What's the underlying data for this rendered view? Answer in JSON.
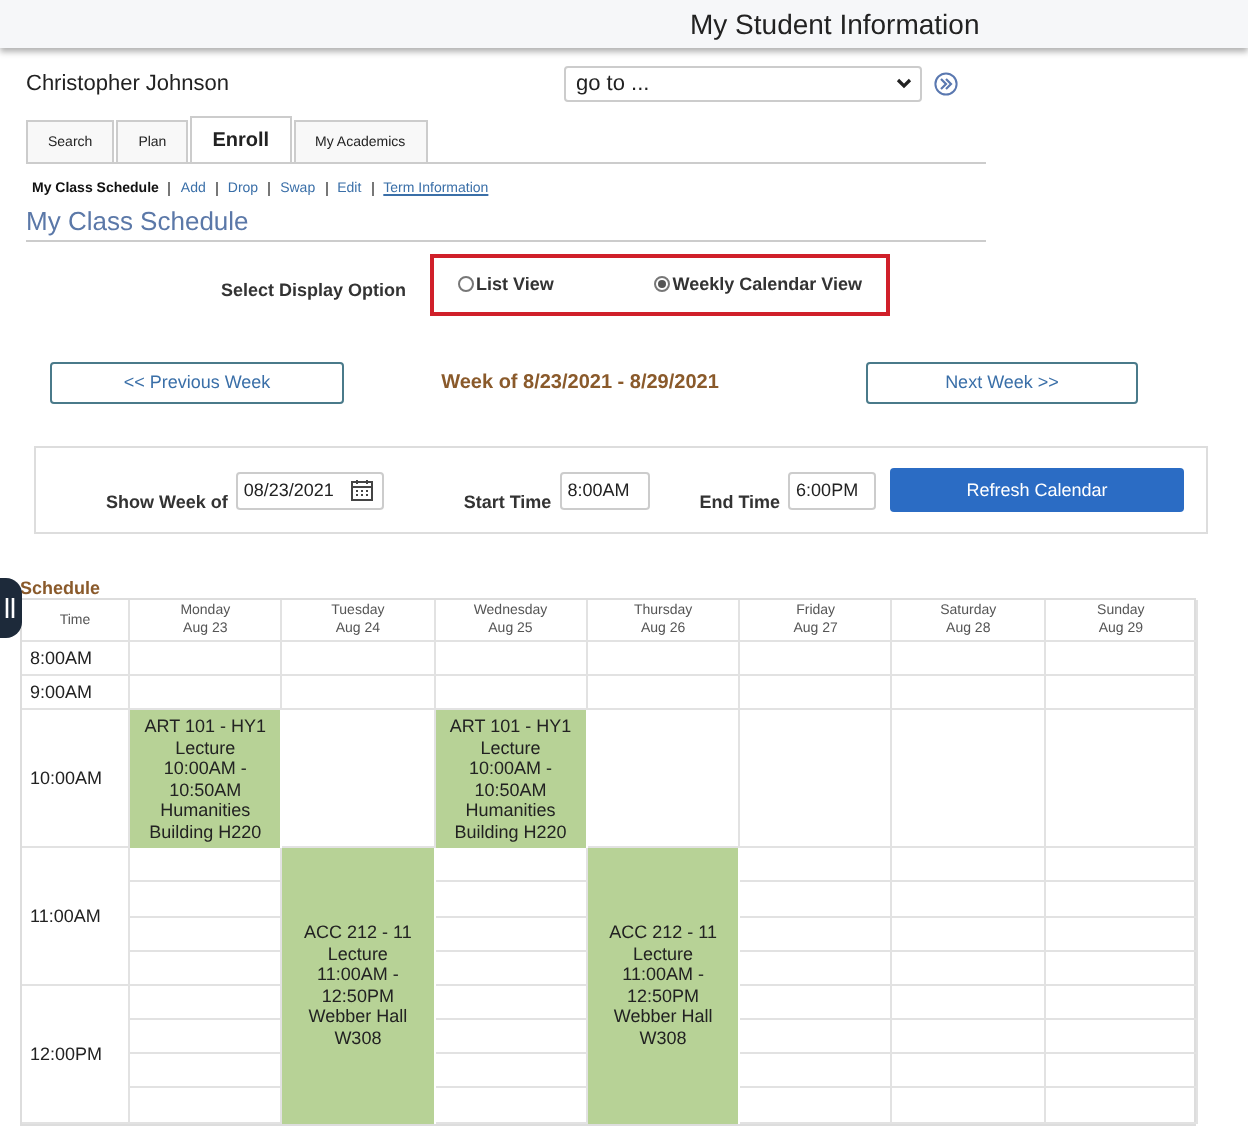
{
  "header": {
    "title": "My Student Information"
  },
  "student_name": "Christopher Johnson",
  "goto": {
    "value": "go to ..."
  },
  "tabs": [
    {
      "label": "Search",
      "selected": false
    },
    {
      "label": "Plan",
      "selected": false
    },
    {
      "label": "Enroll",
      "selected": true
    },
    {
      "label": "My Academics",
      "selected": false
    }
  ],
  "sub_links": [
    {
      "label": "My Class Schedule",
      "selected": true
    },
    {
      "label": "Add",
      "selected": false
    },
    {
      "label": "Drop",
      "selected": false
    },
    {
      "label": "Swap",
      "selected": false
    },
    {
      "label": "Edit",
      "selected": false
    },
    {
      "label": "Term Information",
      "selected": false
    }
  ],
  "page_title": "My Class Schedule",
  "display_option": {
    "label": "Select Display Option",
    "options": [
      {
        "label": "List View",
        "selected": false
      },
      {
        "label": "Weekly Calendar View",
        "selected": true
      }
    ]
  },
  "week_nav": {
    "previous": "<< Previous Week",
    "title": "Week of 8/23/2021 - 8/29/2021",
    "next": "Next Week >>"
  },
  "filters": {
    "show_week_label": "Show Week of",
    "show_week_value": "08/23/2021",
    "start_label": "Start Time",
    "start_value": "8:00AM",
    "end_label": "End Time",
    "end_value": "6:00PM",
    "button": "Refresh Calendar"
  },
  "schedule": {
    "title": "Schedule",
    "time_header": "Time",
    "days": [
      {
        "name": "Monday",
        "date": "Aug 23"
      },
      {
        "name": "Tuesday",
        "date": "Aug 24"
      },
      {
        "name": "Wednesday",
        "date": "Aug 25"
      },
      {
        "name": "Thursday",
        "date": "Aug 26"
      },
      {
        "name": "Friday",
        "date": "Aug 27"
      },
      {
        "name": "Saturday",
        "date": "Aug 28"
      },
      {
        "name": "Sunday",
        "date": "Aug 29"
      }
    ],
    "rows": [
      {
        "time": "8:00AM",
        "kind": "short",
        "cells": [
          {
            "kind": "empty"
          },
          {
            "kind": "empty"
          },
          {
            "kind": "empty"
          },
          {
            "kind": "empty"
          },
          {
            "kind": "empty"
          },
          {
            "kind": "empty"
          },
          {
            "kind": "empty"
          }
        ]
      },
      {
        "time": "9:00AM",
        "kind": "short",
        "cells": [
          {
            "kind": "empty"
          },
          {
            "kind": "empty"
          },
          {
            "kind": "empty"
          },
          {
            "kind": "empty"
          },
          {
            "kind": "empty"
          },
          {
            "kind": "empty"
          },
          {
            "kind": "empty"
          }
        ]
      },
      {
        "time": "10:00AM",
        "kind": "tall",
        "cells": [
          {
            "kind": "event",
            "lines": [
              "ART 101 - HY1",
              "Lecture",
              "10:00AM -",
              "10:50AM",
              "Humanities",
              "Building H220"
            ]
          },
          {
            "kind": "empty"
          },
          {
            "kind": "event",
            "lines": [
              "ART 101 - HY1",
              "Lecture",
              "10:00AM -",
              "10:50AM",
              "Humanities",
              "Building H220"
            ]
          },
          {
            "kind": "empty"
          },
          {
            "kind": "empty"
          },
          {
            "kind": "empty"
          },
          {
            "kind": "empty"
          }
        ]
      },
      {
        "time": "11:00AM",
        "kind": "divided",
        "cells": [
          {
            "kind": "empty"
          },
          {
            "kind": "event",
            "lines": [
              "ACC 212 - 11",
              "Lecture",
              "11:00AM -",
              "12:50PM",
              "Webber Hall",
              "W308"
            ]
          },
          {
            "kind": "empty"
          },
          {
            "kind": "event",
            "lines": [
              "ACC 212 - 11",
              "Lecture",
              "11:00AM -",
              "12:50PM",
              "Webber Hall",
              "W308"
            ]
          },
          {
            "kind": "empty"
          },
          {
            "kind": "empty"
          },
          {
            "kind": "empty"
          }
        ]
      },
      {
        "time": "12:00PM",
        "kind": "divided",
        "cells": [
          {
            "kind": "empty"
          },
          {
            "kind": "continued"
          },
          {
            "kind": "empty"
          },
          {
            "kind": "continued"
          },
          {
            "kind": "empty"
          },
          {
            "kind": "empty"
          },
          {
            "kind": "empty"
          }
        ]
      }
    ]
  }
}
